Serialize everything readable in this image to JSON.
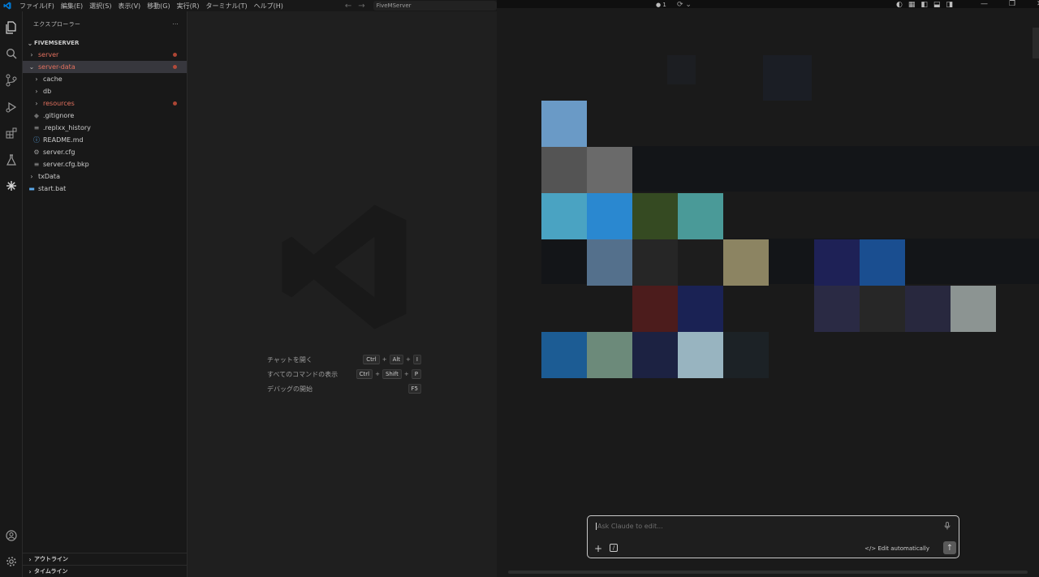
{
  "titlebar": {
    "menu": [
      "ファイル(F)",
      "編集(E)",
      "選択(S)",
      "表示(V)",
      "移動(G)",
      "実行(R)",
      "ターミナル(T)",
      "ヘルプ(H)"
    ],
    "search_text": "FiveMServer",
    "badge": "1",
    "logo_color": "#0078d4"
  },
  "activitybar": {
    "icons": [
      "explorer-icon",
      "search-icon",
      "source-control-icon",
      "run-debug-icon",
      "extensions-icon",
      "testing-icon",
      "claude-icon",
      "account-icon",
      "settings-icon"
    ]
  },
  "sidebar": {
    "header": "エクスプローラー",
    "more": "···",
    "root": "FIVEMSERVER",
    "tree": [
      {
        "label": "server",
        "type": "folder",
        "indent": 0,
        "red": true,
        "dot": true
      },
      {
        "label": "server-data",
        "type": "folder-open",
        "indent": 0,
        "red": true,
        "dot": true,
        "selected": true
      },
      {
        "label": "cache",
        "type": "folder",
        "indent": 1
      },
      {
        "label": "db",
        "type": "folder",
        "indent": 1
      },
      {
        "label": "resources",
        "type": "folder",
        "indent": 1,
        "red": true,
        "dot": true
      },
      {
        "label": ".gitignore",
        "type": "file-git",
        "indent": 1
      },
      {
        "label": ".replxx_history",
        "type": "file-lines",
        "indent": 1
      },
      {
        "label": "README.md",
        "type": "file-info",
        "indent": 1
      },
      {
        "label": "server.cfg",
        "type": "file-gear",
        "indent": 1
      },
      {
        "label": "server.cfg.bkp",
        "type": "file-lines",
        "indent": 1
      },
      {
        "label": "txData",
        "type": "folder",
        "indent": 0
      },
      {
        "label": "start.bat",
        "type": "file-bat",
        "indent": 0
      }
    ],
    "outline": "アウトライン",
    "timeline": "タイムライン"
  },
  "editor": {
    "shortcuts": [
      {
        "label": "チャットを開く",
        "keys": [
          "Ctrl",
          "Alt",
          "I"
        ]
      },
      {
        "label": "すべてのコマンドの表示",
        "keys": [
          "Ctrl",
          "Shift",
          "P"
        ]
      },
      {
        "label": "デバッグの開始",
        "keys": [
          "F5"
        ]
      }
    ]
  },
  "right_panel": {
    "bg": "#1a1a1a",
    "blocks": [
      {
        "c": "#6a9ac6",
        "r": 0,
        "col": 0
      },
      {
        "c": "#545454",
        "r": 1,
        "col": 0
      },
      {
        "c": "#6a6a6a",
        "r": 1,
        "col": 1
      },
      {
        "c": "#4aa3c2",
        "r": 2,
        "col": 0
      },
      {
        "c": "#2a88d0",
        "r": 2,
        "col": 1
      },
      {
        "c": "#354a22",
        "r": 2,
        "col": 2
      },
      {
        "c": "#4a9a98",
        "r": 2,
        "col": 3
      },
      {
        "c": "#54708c",
        "r": 3,
        "col": 1
      },
      {
        "c": "#262626",
        "r": 3,
        "col": 2
      },
      {
        "c": "#1d1d1d",
        "r": 3,
        "col": 3
      },
      {
        "c": "#8c8462",
        "r": 3,
        "col": 4
      },
      {
        "c": "#1e2156",
        "r": 3,
        "col": 6
      },
      {
        "c": "#1a4e90",
        "r": 3,
        "col": 7
      },
      {
        "c": "#4c1c1c",
        "r": 4,
        "col": 2
      },
      {
        "c": "#1a2254",
        "r": 4,
        "col": 3
      },
      {
        "c": "#2a2a44",
        "r": 4,
        "col": 6
      },
      {
        "c": "#272727",
        "r": 4,
        "col": 7
      },
      {
        "c": "#28283e",
        "r": 4,
        "col": 8
      },
      {
        "c": "#8c9492",
        "r": 4,
        "col": 9
      },
      {
        "c": "#1c5c94",
        "r": 5,
        "col": 0
      },
      {
        "c": "#6c8a7a",
        "r": 5,
        "col": 1
      },
      {
        "c": "#1c2242",
        "r": 5,
        "col": 2
      },
      {
        "c": "#98b4c0",
        "r": 5,
        "col": 3
      },
      {
        "c": "#1c2226",
        "r": 5,
        "col": 4
      }
    ]
  },
  "chat": {
    "placeholder": "Ask Claude to edit...",
    "edit_mode": "Edit automatically",
    "edit_mode_icon": "</>",
    "plus": "+",
    "send": "↑"
  }
}
